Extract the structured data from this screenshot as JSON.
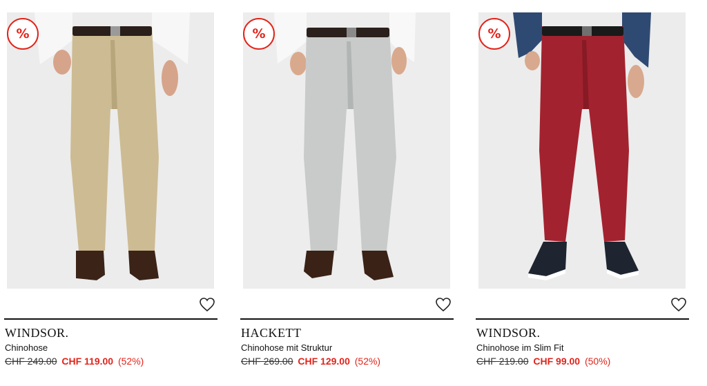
{
  "products": [
    {
      "brand": "WINDSOR.",
      "name": "Chinohose",
      "old_price": "CHF 249.00",
      "new_price": "CHF 119.00",
      "discount": "(52%)",
      "badge": "%",
      "colors": {
        "bg": "#ececec",
        "pants": "#cdbb93",
        "pants_shadow": "#b7a57c",
        "shirt": "#f7f7f7",
        "belt": "#2a1f1a",
        "shoes": "#3b2318",
        "skin": "#d6a48a"
      },
      "wishlist_icon": "heart-outline"
    },
    {
      "brand": "HACKETT",
      "name": "Chinohose mit Struktur",
      "old_price": "CHF 269.00",
      "new_price": "CHF 129.00",
      "discount": "(52%)",
      "badge": "%",
      "colors": {
        "bg": "#ededed",
        "pants": "#c8cbc9",
        "pants_shadow": "#b1b5b3",
        "shirt": "#f8f8f8",
        "belt": "#2b201b",
        "shoes": "#3a2216",
        "skin": "#d9a98d"
      },
      "wishlist_icon": "heart-outline"
    },
    {
      "brand": "WINDSOR.",
      "name": "Chinohose im Slim Fit",
      "old_price": "CHF 219.00",
      "new_price": "CHF 99.00",
      "discount": "(50%)",
      "badge": "%",
      "colors": {
        "bg": "#ececec",
        "pants": "#a3222f",
        "pants_shadow": "#861a25",
        "shirt": "#2f4a72",
        "belt": "#1a1a1a",
        "shoes": "#1e2530",
        "skin": "#d8a98e"
      },
      "wishlist_icon": "heart-outline"
    }
  ],
  "accent_color": "#e2231a"
}
